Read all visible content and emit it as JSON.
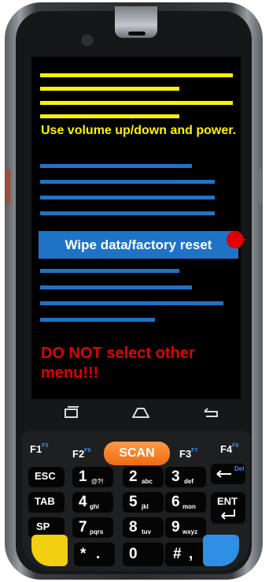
{
  "screen": {
    "instruction": "Use volume up/down and power.",
    "selected_item": "Wipe data/factory reset",
    "warning": "DO NOT select other menu!!!",
    "colors": {
      "highlight_text": "#fff200",
      "menu_item": "#1f73c6",
      "warning": "#e10000",
      "marker": "#e00000"
    }
  },
  "nav_bar": {
    "back_icon": "back-icon",
    "home_icon": "home-icon",
    "recents_icon": "recents-icon"
  },
  "keypad": {
    "f_keys": [
      {
        "label": "F1",
        "sub": "F5"
      },
      {
        "label": "F2",
        "sub": "F6"
      },
      {
        "label": "F3",
        "sub": "F7"
      },
      {
        "label": "F4",
        "sub": "F8"
      }
    ],
    "scan_label": "SCAN",
    "esc_label": "ESC",
    "tab_label": "TAB",
    "sp_label": "SP",
    "ent_label": "ENT",
    "del_label": "Del",
    "digits": [
      {
        "main": "1",
        "sub": "@?!"
      },
      {
        "main": "2",
        "sub": "abc"
      },
      {
        "main": "3",
        "sub": "def"
      },
      {
        "main": "4",
        "sub": "ghi"
      },
      {
        "main": "5",
        "sub": "jkl"
      },
      {
        "main": "6",
        "sub": "mon"
      },
      {
        "main": "7",
        "sub": "pqrs"
      },
      {
        "main": "8",
        "sub": "tuv"
      },
      {
        "main": "9",
        "sub": "wxyz"
      }
    ],
    "bottom": {
      "star": "*",
      "dot": ".",
      "zero": "0",
      "hash": "#",
      "comma": ","
    }
  }
}
